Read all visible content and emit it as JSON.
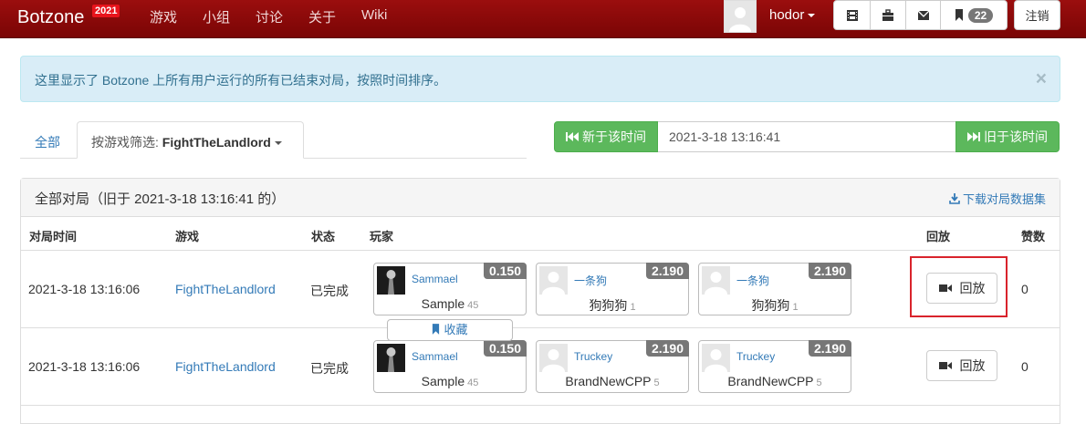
{
  "navbar": {
    "brand": "Botzone",
    "brand_year": "2021",
    "links": [
      "游戏",
      "小组",
      "讨论",
      "关于",
      "Wiki"
    ],
    "username": "hodor",
    "badge_count": "22",
    "logout_label": "注销",
    "icons": [
      "film-icon",
      "briefcase-icon",
      "envelope-icon",
      "bookmark-icon"
    ]
  },
  "alert": {
    "text": "这里显示了 Botzone 上所有用户运行的所有已结束对局，按照时间排序。",
    "close": "×"
  },
  "tabs": {
    "all_label": "全部",
    "filter_prefix": "按游戏筛选: ",
    "filter_value": "FightTheLandlord"
  },
  "time_search": {
    "newer_label": "新于该时间",
    "older_label": "旧于该时间",
    "value": "2021-3-18 13:16:41"
  },
  "panel": {
    "title": "全部对局（旧于 2021-3-18 13:16:41 的）",
    "download_label": "下载对局数据集",
    "columns": {
      "time": "对局时间",
      "game": "游戏",
      "status": "状态",
      "players": "玩家",
      "replay": "回放",
      "likes": "赞数"
    }
  },
  "matches": [
    {
      "time": "2021-3-18 13:16:06",
      "game": "FightTheLandlord",
      "status": "已完成",
      "replay_label": "回放",
      "likes": "0",
      "players": [
        {
          "bot": "Sammael",
          "score": "0.150",
          "name": "Sample",
          "version": "45",
          "avatar": "dark"
        },
        {
          "bot": "一条狗",
          "score": "2.190",
          "name": "狗狗狗",
          "version": "1",
          "avatar": "default"
        },
        {
          "bot": "一条狗",
          "score": "2.190",
          "name": "狗狗狗",
          "version": "1",
          "avatar": "default"
        }
      ]
    },
    {
      "time": "2021-3-18 13:16:06",
      "game": "FightTheLandlord",
      "status": "已完成",
      "replay_label": "回放",
      "likes": "0",
      "players": [
        {
          "bot": "Sammael",
          "score": "0.150",
          "name": "Sample",
          "version": "45",
          "avatar": "dark"
        },
        {
          "bot": "Truckey",
          "score": "2.190",
          "name": "BrandNewCPP",
          "version": "5",
          "avatar": "default"
        },
        {
          "bot": "Truckey",
          "score": "2.190",
          "name": "BrandNewCPP",
          "version": "5",
          "avatar": "default"
        }
      ]
    }
  ],
  "favorite_label": "收藏",
  "colors": {
    "navbar": "#8b0a0a",
    "green": "#5cb85c",
    "link": "#337ab7",
    "highlight": "#d9232c"
  }
}
